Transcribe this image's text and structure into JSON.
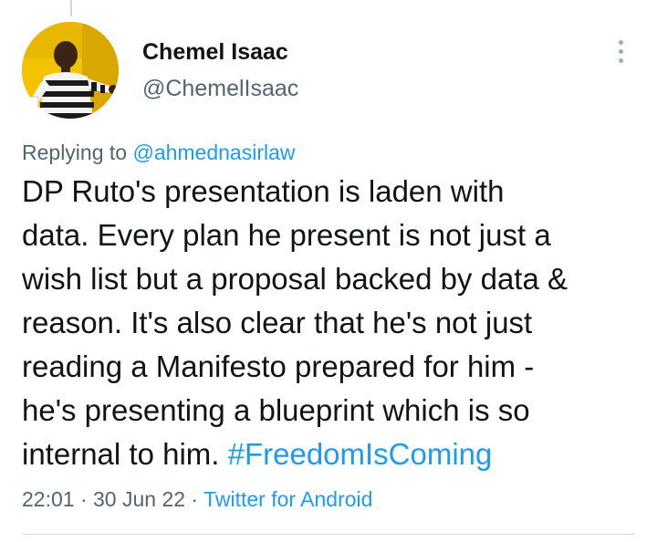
{
  "user": {
    "name": "Chemel Isaac",
    "handle": "@ChemelIsaac"
  },
  "reply": {
    "prefix": "Replying to ",
    "to": "@ahmednasirlaw"
  },
  "tweet": {
    "lines": [
      "DP Ruto's presentation is laden with",
      "data. Every plan he present is not just a",
      "wish list but a proposal backed by data &",
      "reason. It's also clear that he's not just",
      "reading a Manifesto prepared for him -",
      "he's presenting a blueprint which is so",
      "internal to him. "
    ],
    "hashtag": "#FreedomIsComing"
  },
  "meta": {
    "time": "22:01",
    "sep1": " · ",
    "date": "30 Jun 22",
    "sep2": " · ",
    "source": "Twitter for Android"
  },
  "icons": {
    "more": "more-vertical-icon"
  },
  "colors": {
    "link": "#1d9bf0",
    "text": "#0f1419",
    "muted": "#536471",
    "divider": "#cfd9de"
  }
}
